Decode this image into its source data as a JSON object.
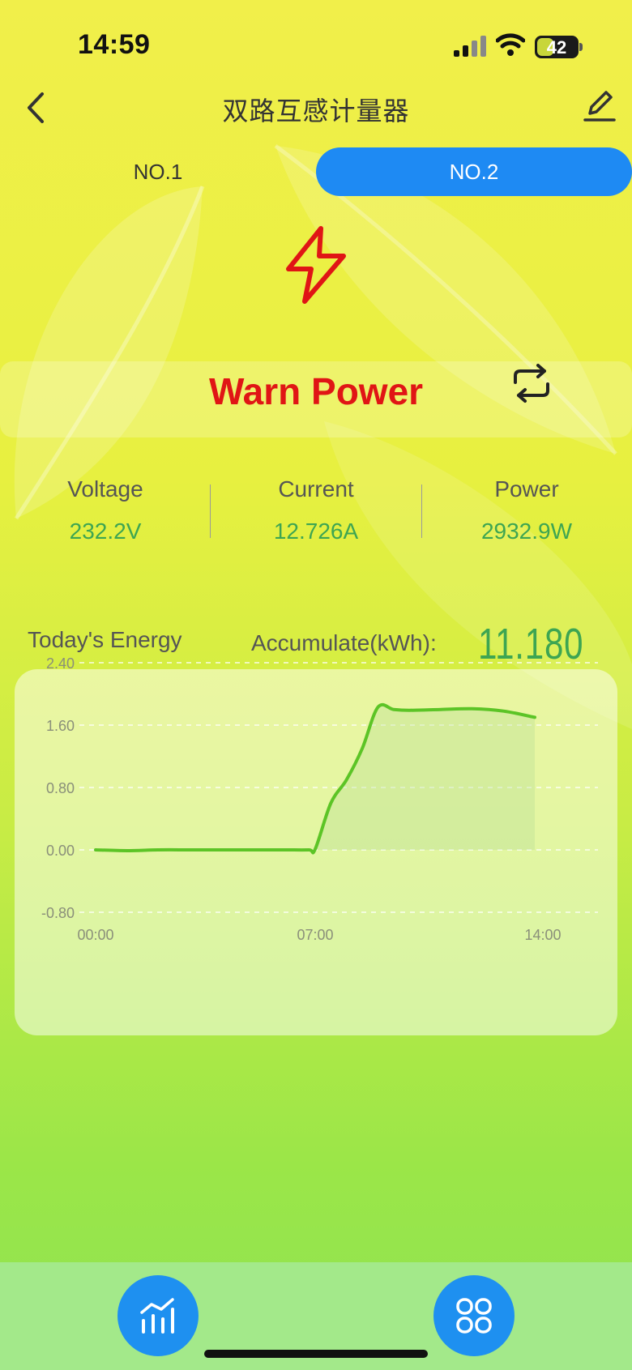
{
  "status_bar": {
    "time": "14:59",
    "battery_level": "42",
    "battery_fraction": 0.42
  },
  "header": {
    "title": "双路互感计量器",
    "back_icon": "chevron-left-icon",
    "edit_icon": "pencil-icon"
  },
  "tabs": [
    {
      "label": "NO.1",
      "active": false
    },
    {
      "label": "NO.2",
      "active": true
    }
  ],
  "alert": {
    "icon": "lightning-bolt-icon",
    "text": "Warn Power",
    "color": "#e01515",
    "toggle_icon": "swap-refresh-icon"
  },
  "metrics": [
    {
      "label": "Voltage",
      "value": "232.2V"
    },
    {
      "label": "Current",
      "value": "12.726A"
    },
    {
      "label": "Power",
      "value": "2932.9W"
    }
  ],
  "energy": {
    "today_label": "Today's Energy",
    "accumulate_label": "Accumulate(kWh):",
    "accumulate_value": "11.180"
  },
  "chart_data": {
    "type": "area",
    "x_ticks": [
      "00:00",
      "07:00",
      "14:00"
    ],
    "y_ticks": [
      "2.40",
      "1.60",
      "0.80",
      "0.00",
      "-0.80"
    ],
    "ylim": [
      -0.8,
      2.4
    ],
    "x_hours": [
      0,
      1,
      2,
      3,
      4,
      5,
      6,
      6.8,
      7,
      7.5,
      8,
      8.5,
      9,
      9.5,
      10,
      11,
      12,
      13,
      14
    ],
    "values": [
      0.0,
      -0.01,
      0.0,
      0.0,
      0.0,
      0.0,
      0.0,
      0.0,
      0.01,
      0.6,
      0.9,
      1.3,
      1.83,
      1.8,
      1.79,
      1.8,
      1.81,
      1.78,
      1.7
    ],
    "grid": true,
    "line_color": "#5cc426"
  },
  "bottom_nav": [
    {
      "icon": "chart-stats-icon"
    },
    {
      "icon": "grid-menu-icon"
    }
  ],
  "colors": {
    "accent": "#1e8af3",
    "value_green": "#3da552"
  }
}
